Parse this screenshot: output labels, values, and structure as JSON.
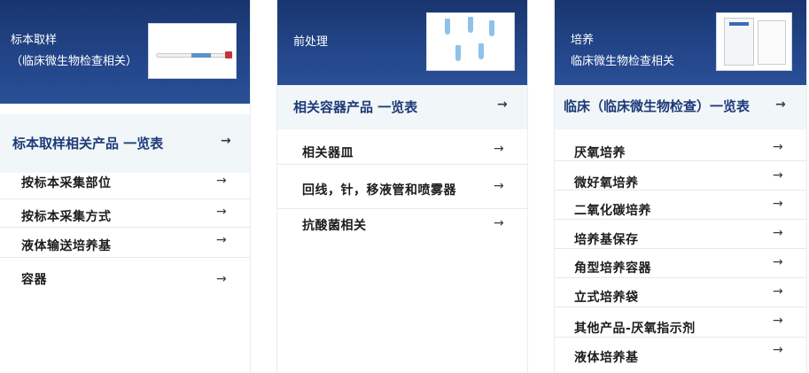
{
  "cards": [
    {
      "header_lines": [
        "标本取样",
        "（临床微生物检查相关）"
      ],
      "image_icon": "swab-tube-icon",
      "list_title": "标本取样相关产品 一览表",
      "items": [
        "按标本采集部位",
        "按标本采集方式",
        "液体输送培养基",
        "容器"
      ]
    },
    {
      "header_lines": [
        "前处理"
      ],
      "image_icon": "centrifuge-tubes-icon",
      "list_title": "相关容器产品 一览表",
      "items": [
        "相关器皿",
        "回线，针，移液管和喷雾器",
        "抗酸菌相关"
      ]
    },
    {
      "header_lines": [
        "培养",
        "临床微生物检查相关"
      ],
      "image_icon": "culture-bag-icon",
      "list_title": "临床（临床微生物检查）一览表",
      "items": [
        "厌氧培养",
        "微好氧培养",
        "二氧化碳培养",
        "培养基保存",
        "角型培养容器",
        "立式培养袋",
        "其他产品-厌氧指示剂",
        "液体培养基"
      ]
    }
  ],
  "arrow_glyph": "→",
  "colors": {
    "header_bg": "#23468a",
    "list_head_bg": "#f1f6f8",
    "list_title": "#1d3a78",
    "item_text": "#1c1c1c",
    "divider": "#e4e7ec"
  }
}
